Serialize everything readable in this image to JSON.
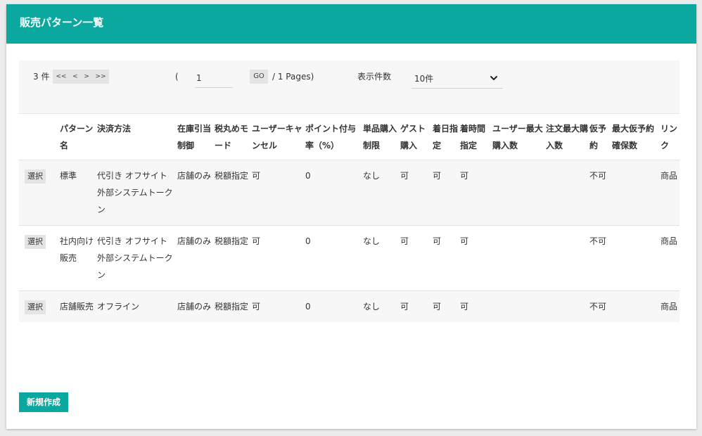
{
  "header": {
    "title": "販売パターン一覧"
  },
  "pager": {
    "count": "3 件",
    "nav": [
      "<<",
      "<",
      ">",
      ">>"
    ],
    "open_paren": "(",
    "page_value": "1",
    "go_label": "GO",
    "pages_text": "/ 1 Pages)",
    "per_page_label": "表示件数",
    "per_page_value": "10件"
  },
  "table": {
    "columns": [
      "",
      "パターン名",
      "決済方法",
      "在庫引当制御",
      "税丸めモード",
      "ユーザーキャンセル",
      "ポイント付与率（%）",
      "単品購入制限",
      "ゲスト購入",
      "着日指定",
      "着時間指定",
      "ユーザー最大購入数",
      "注文最大購入数",
      "仮予約",
      "最大仮予約確保数",
      "リンク"
    ],
    "select_label": "選択",
    "rows": [
      [
        "",
        "標準",
        "代引き オフサイト 外部システムトークン",
        "店舗のみ",
        "税額指定",
        "可",
        "0",
        "なし",
        "可",
        "可",
        "可",
        "",
        "",
        "不可",
        "",
        "商品"
      ],
      [
        "",
        "社内向け販売",
        "代引き オフサイト 外部システムトークン",
        "店舗のみ",
        "税額指定",
        "可",
        "0",
        "なし",
        "可",
        "可",
        "可",
        "",
        "",
        "不可",
        "",
        "商品"
      ],
      [
        "",
        "店舗販売",
        "オフライン",
        "店舗のみ",
        "税額指定",
        "可",
        "0",
        "なし",
        "可",
        "可",
        "可",
        "",
        "",
        "不可",
        "",
        "商品"
      ]
    ]
  },
  "footer": {
    "create_label": "新規作成"
  },
  "colors": {
    "accent": "#0ba8a0",
    "button_gray": "#e4e4e4",
    "row_alt": "#f6f7f6"
  }
}
